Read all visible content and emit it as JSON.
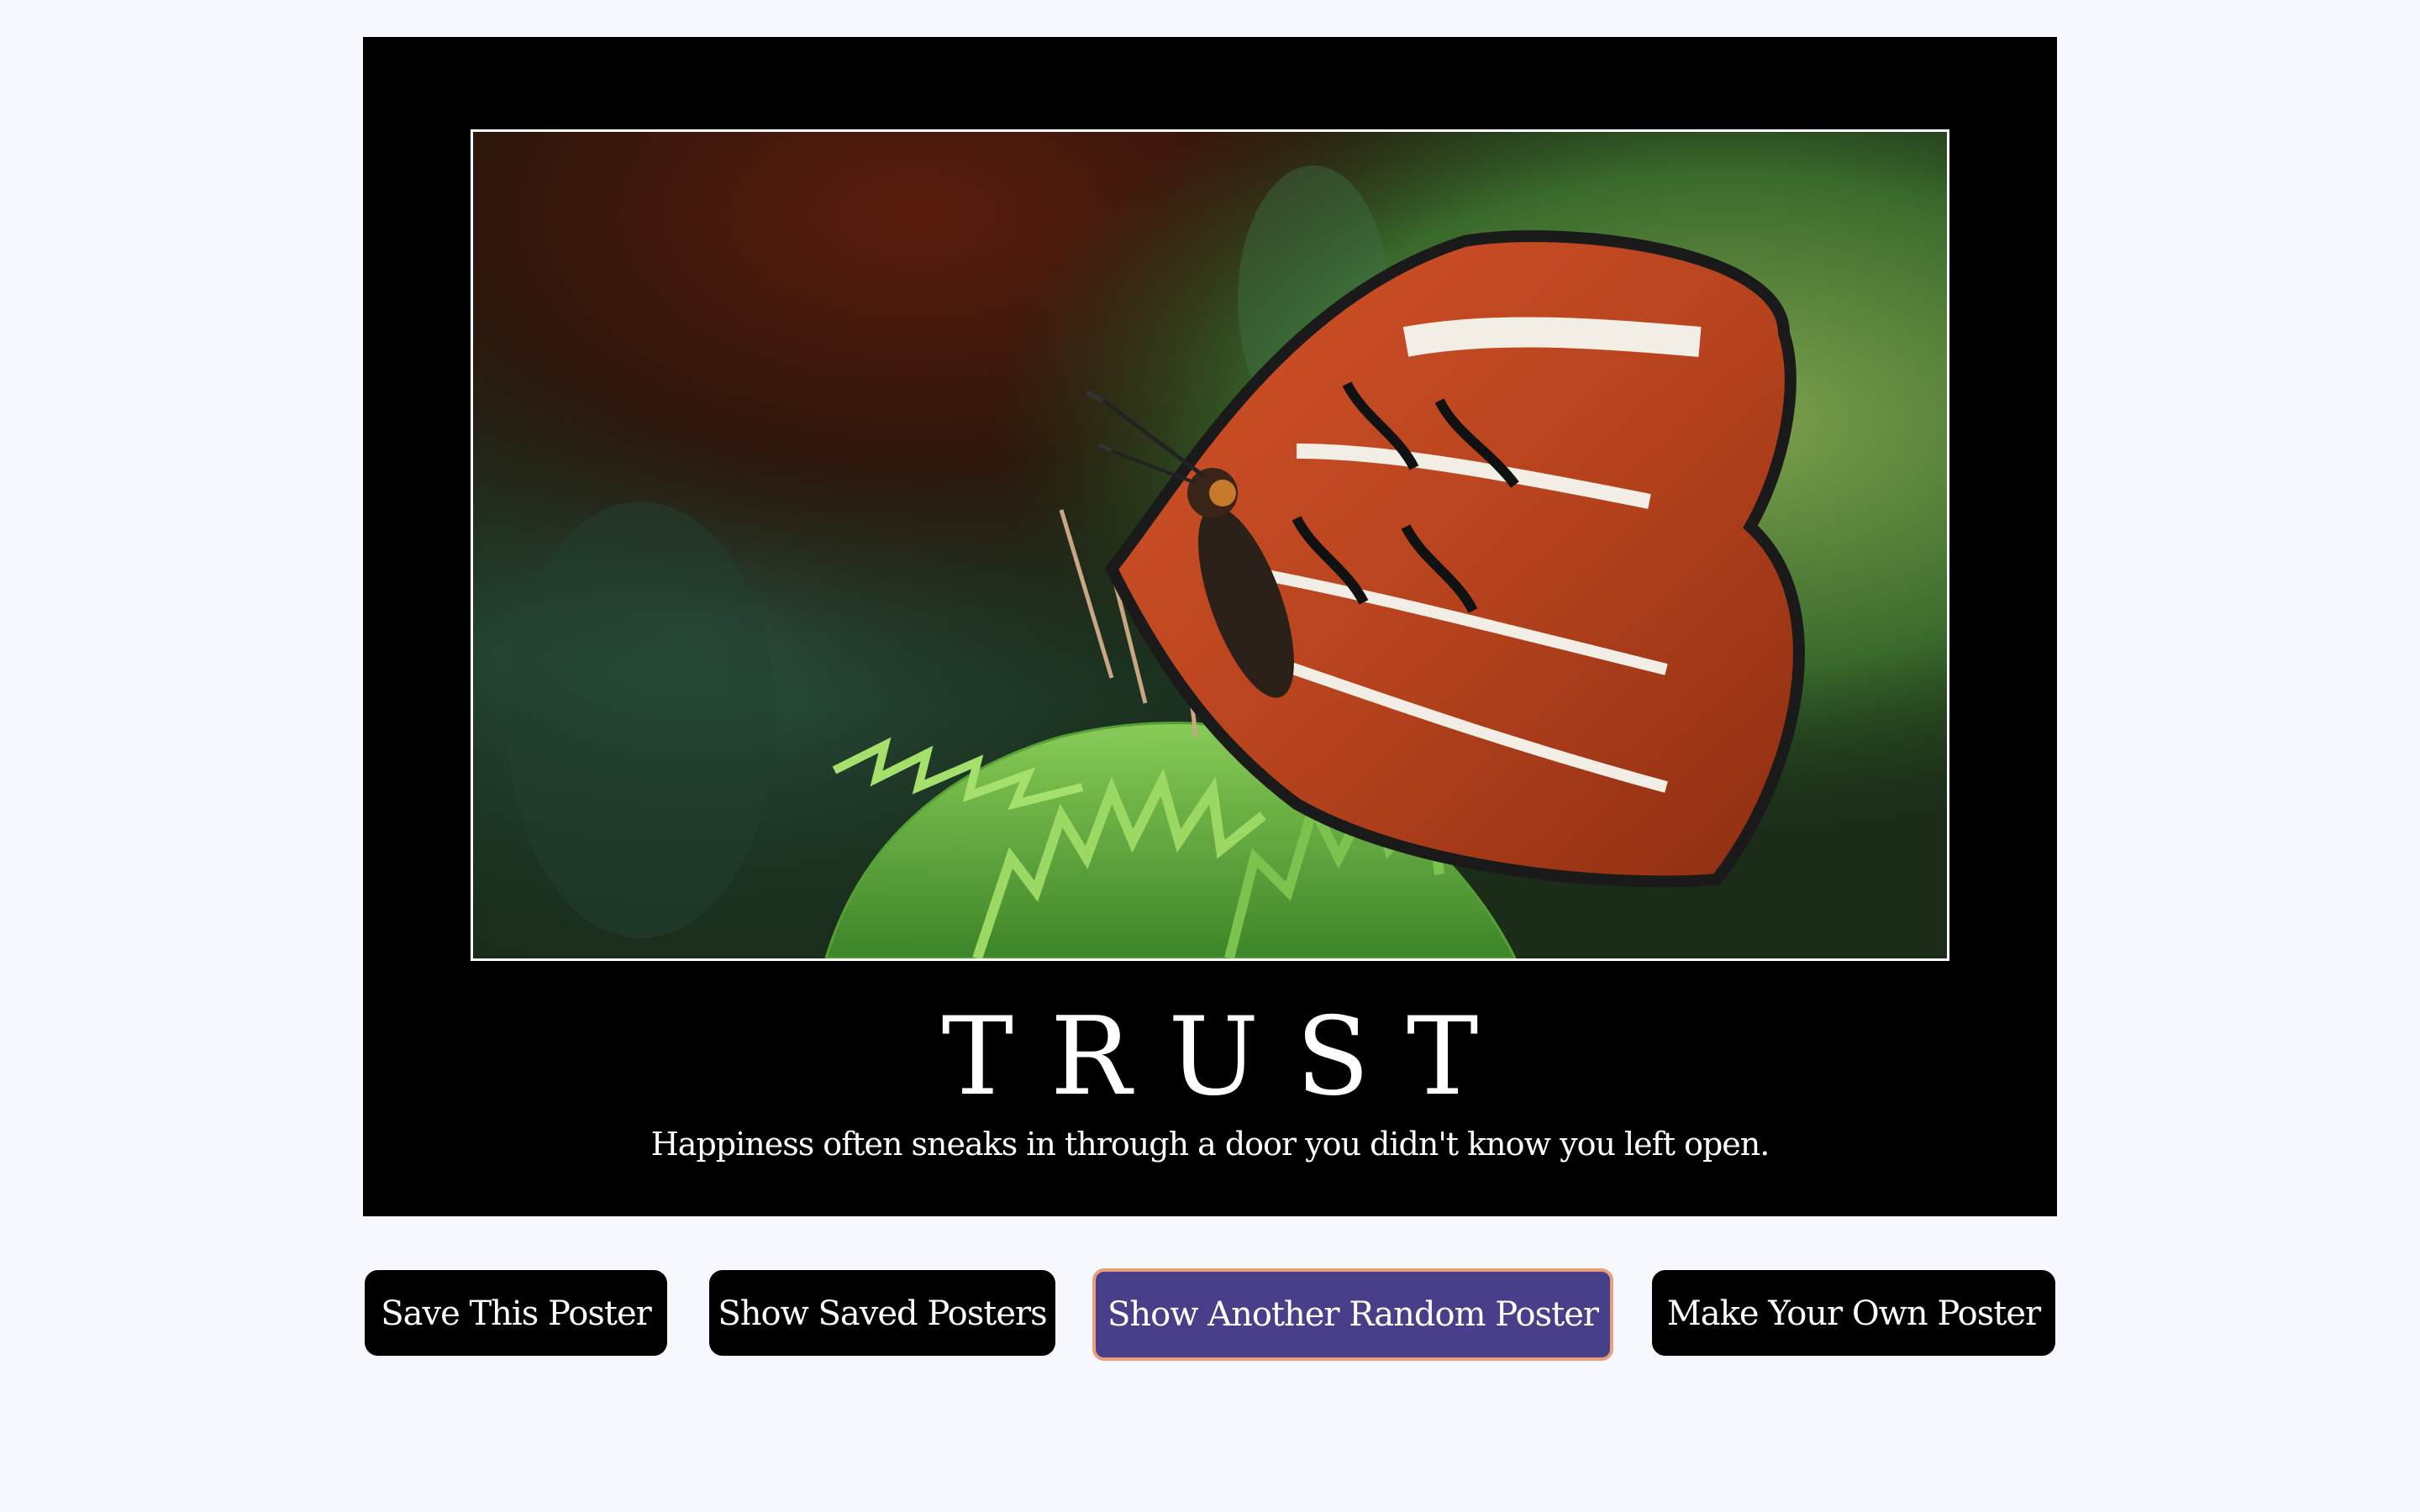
{
  "poster": {
    "title": "TRUST",
    "quote": "Happiness often sneaks in through a door you didn't know you left open.",
    "image_subject": "butterfly-on-fern",
    "background_color": "#000000",
    "frame_color": "#ffffff"
  },
  "buttons": {
    "save_label": "Save This Poster",
    "show_saved_label": "Show Saved Posters",
    "random_label": "Show Another Random Poster",
    "make_label": "Make Your Own Poster"
  },
  "colors": {
    "page_background": "#f7f8fd",
    "button_background": "#000000",
    "active_button_background": "#483f8b",
    "active_button_border": "#e8a07a"
  }
}
